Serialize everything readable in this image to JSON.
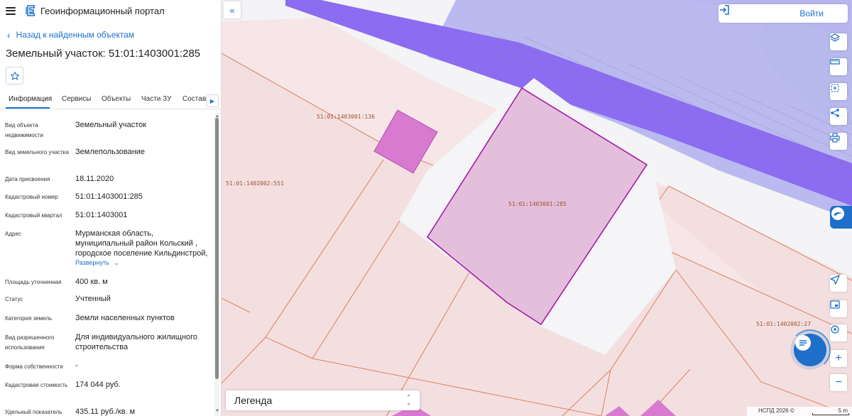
{
  "app": {
    "title": "Геоинформационный портал",
    "back_label": "Назад к найденным объектам",
    "object_title": "Земельный участок: 51:01:1403001:285"
  },
  "tabs": [
    {
      "label": "Информация",
      "active": true
    },
    {
      "label": "Сервисы",
      "active": false
    },
    {
      "label": "Объекты",
      "active": false
    },
    {
      "label": "Части ЗУ",
      "active": false
    },
    {
      "label": "Состав",
      "active": false
    }
  ],
  "properties": {
    "type": {
      "label": "Вид объекта недвижимости",
      "value": "Земельный участок"
    },
    "kind": {
      "label": "Вид земельного участка",
      "value": "Землепользование"
    },
    "date": {
      "label": "Дата присвоения",
      "value": "18.11.2020"
    },
    "cad_number": {
      "label": "Кадастровый номер",
      "value": "51:01:1403001:285"
    },
    "cad_quarter": {
      "label": "Кадастровый квартал",
      "value": "51:01:1403001"
    },
    "address": {
      "label": "Адрес",
      "line1": "Мурманская область,",
      "line2": "муниципальный район Кольский ,",
      "line3": "городское поселение Кильдинстрой,",
      "expand_label": "Развернуть"
    },
    "area": {
      "label": "Площадь уточненная",
      "value": "400 кв. м"
    },
    "status": {
      "label": "Статус",
      "value": "Учтенный"
    },
    "category": {
      "label": "Категория земель",
      "value": "Земли населенных пунктов"
    },
    "permitted_use": {
      "label": "Вид разрешенного использования",
      "value_line1": "Для индивидуального жилищного",
      "value_line2": "строительства"
    },
    "ownership": {
      "label": "Форма собственности",
      "value": "-"
    },
    "cad_value": {
      "label": "Кадастровая стоимость",
      "value": "174 044 руб."
    },
    "specific": {
      "label": "Удельный показатель",
      "value": "435.11 руб./кв. м"
    }
  },
  "map": {
    "parcel_labels": {
      "main": "51:01:1403001:285",
      "n136": "51:01:1403001:136",
      "n551": "51:01:1402002:551",
      "n27": "51:01:1402002:27"
    },
    "login_label": "Войти",
    "legend_label": "Легенда",
    "attribution": "НСПД 2026 ©",
    "scale_label": "5 m",
    "colors": {
      "parcel_fill": "#f4dfe0",
      "parcel_stroke": "#d9805f",
      "selected_fill": "#e2b9d8",
      "selected_stroke": "#a21ca8",
      "road_outer": "#b7b6ef",
      "road_inner": "#8c6cf0",
      "building": "#d77ad0",
      "green": "#b6d59f",
      "accent": "#1d6fc9"
    }
  }
}
